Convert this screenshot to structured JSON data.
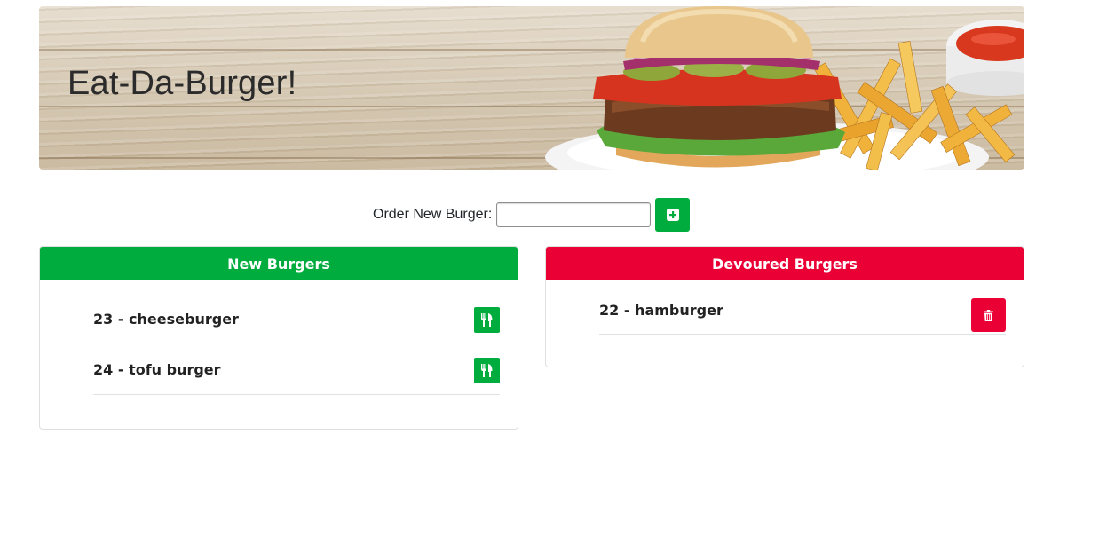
{
  "header": {
    "title": "Eat-Da-Burger!",
    "banner_image": "burger-and-fries-photo"
  },
  "order_form": {
    "label": "Order New Burger:",
    "input_value": "",
    "input_placeholder": "",
    "submit_icon": "plus-square-icon"
  },
  "new_burgers": {
    "heading": "New Burgers",
    "color": "#00ac3e",
    "items": [
      {
        "label": "23 - cheeseburger",
        "action_icon": "utensils-icon"
      },
      {
        "label": "24 - tofu burger",
        "action_icon": "utensils-icon"
      }
    ]
  },
  "devoured_burgers": {
    "heading": "Devoured Burgers",
    "color": "#eb0036",
    "items": [
      {
        "label": "22 - hamburger",
        "action_icon": "trash-icon"
      }
    ]
  }
}
